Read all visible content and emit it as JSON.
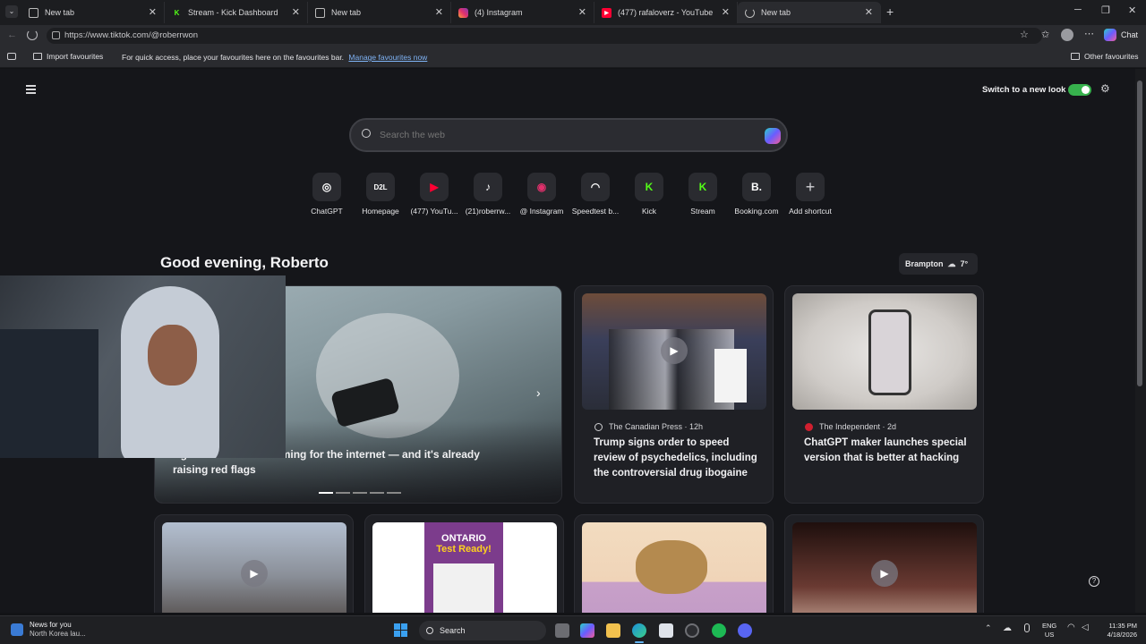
{
  "tabs": [
    {
      "title": "New tab",
      "icon": "page-icon"
    },
    {
      "title": "Stream - Kick Dashboard",
      "icon": "kick-icon"
    },
    {
      "title": "New tab",
      "icon": "page-icon"
    },
    {
      "title": "(4) Instagram",
      "icon": "instagram-icon"
    },
    {
      "title": "(477) rafaloverz - YouTube",
      "icon": "youtube-icon"
    },
    {
      "title": "New tab",
      "icon": "loading-icon"
    }
  ],
  "address": {
    "url": "https://www.tiktok.com/@roberrwon"
  },
  "toolbar": {
    "chat_label": "Chat"
  },
  "favourites": {
    "import_label": "Import favourites",
    "hint": "For quick access, place your favourites here on the favourites bar.",
    "manage_link": "Manage favourites now",
    "other_label": "Other favourites"
  },
  "header": {
    "switch_label": "Switch to a new look",
    "switch_on": true
  },
  "search": {
    "placeholder": "Search the web"
  },
  "shortcuts": [
    {
      "label": "ChatGPT",
      "icon": "chatgpt-icon",
      "glyph": "◎",
      "color": "#ffffff"
    },
    {
      "label": "Homepage",
      "icon": "d2l-icon",
      "glyph": "D2L",
      "color": "#ffffff"
    },
    {
      "label": "(477) YouTu...",
      "icon": "youtube-icon",
      "glyph": "▶",
      "color": "#ff0033"
    },
    {
      "label": "(21)roberrw...",
      "icon": "tiktok-icon",
      "glyph": "♪",
      "color": "#ffffff"
    },
    {
      "label": "@ Instagram",
      "icon": "instagram-icon",
      "glyph": "◉",
      "color": "#e1306c"
    },
    {
      "label": "Speedtest b...",
      "icon": "speedtest-icon",
      "glyph": "◠",
      "color": "#ffffff"
    },
    {
      "label": "Kick",
      "icon": "kick-icon",
      "glyph": "K",
      "color": "#53fc18"
    },
    {
      "label": "Stream",
      "icon": "kick-icon",
      "glyph": "K",
      "color": "#53fc18"
    },
    {
      "label": "Booking.com",
      "icon": "booking-icon",
      "glyph": "B.",
      "color": "#ffffff"
    },
    {
      "label": "Add shortcut",
      "icon": "plus-icon",
      "glyph": "+",
      "color": "#d0d0d4"
    }
  ],
  "greeting": "Good evening, Roberto",
  "weather": {
    "city": "Brampton",
    "temp": "7°"
  },
  "hero": {
    "headline_line1": "Age verification is coming for the internet — and it's already",
    "headline_line2": "raising red flags"
  },
  "news": [
    {
      "source": "The Canadian Press · 12h",
      "headline": "Trump signs order to speed review of psychedelics, including the controversial drug ibogaine"
    },
    {
      "source": "The Independent · 2d",
      "headline": "ChatGPT maker launches special version that is better at hacking"
    }
  ],
  "bottom_cards": [
    {
      "thumb": "piano-video"
    },
    {
      "thumb": "ontario-book",
      "title_line1": "ONTARIO",
      "title_line2": "Test Ready!"
    },
    {
      "thumb": "potato"
    },
    {
      "thumb": "angels-video"
    }
  ],
  "taskbar": {
    "news_title": "News for you",
    "news_sub": "North Korea lau...",
    "search_label": "Search",
    "lang": "ENG",
    "region": "US",
    "time": "11:35 PM",
    "date": "4/18/2026"
  },
  "colors": {
    "accent_toggle": "#37b24d",
    "page_bg": "#15161a",
    "card_bg": "#1f2025"
  }
}
